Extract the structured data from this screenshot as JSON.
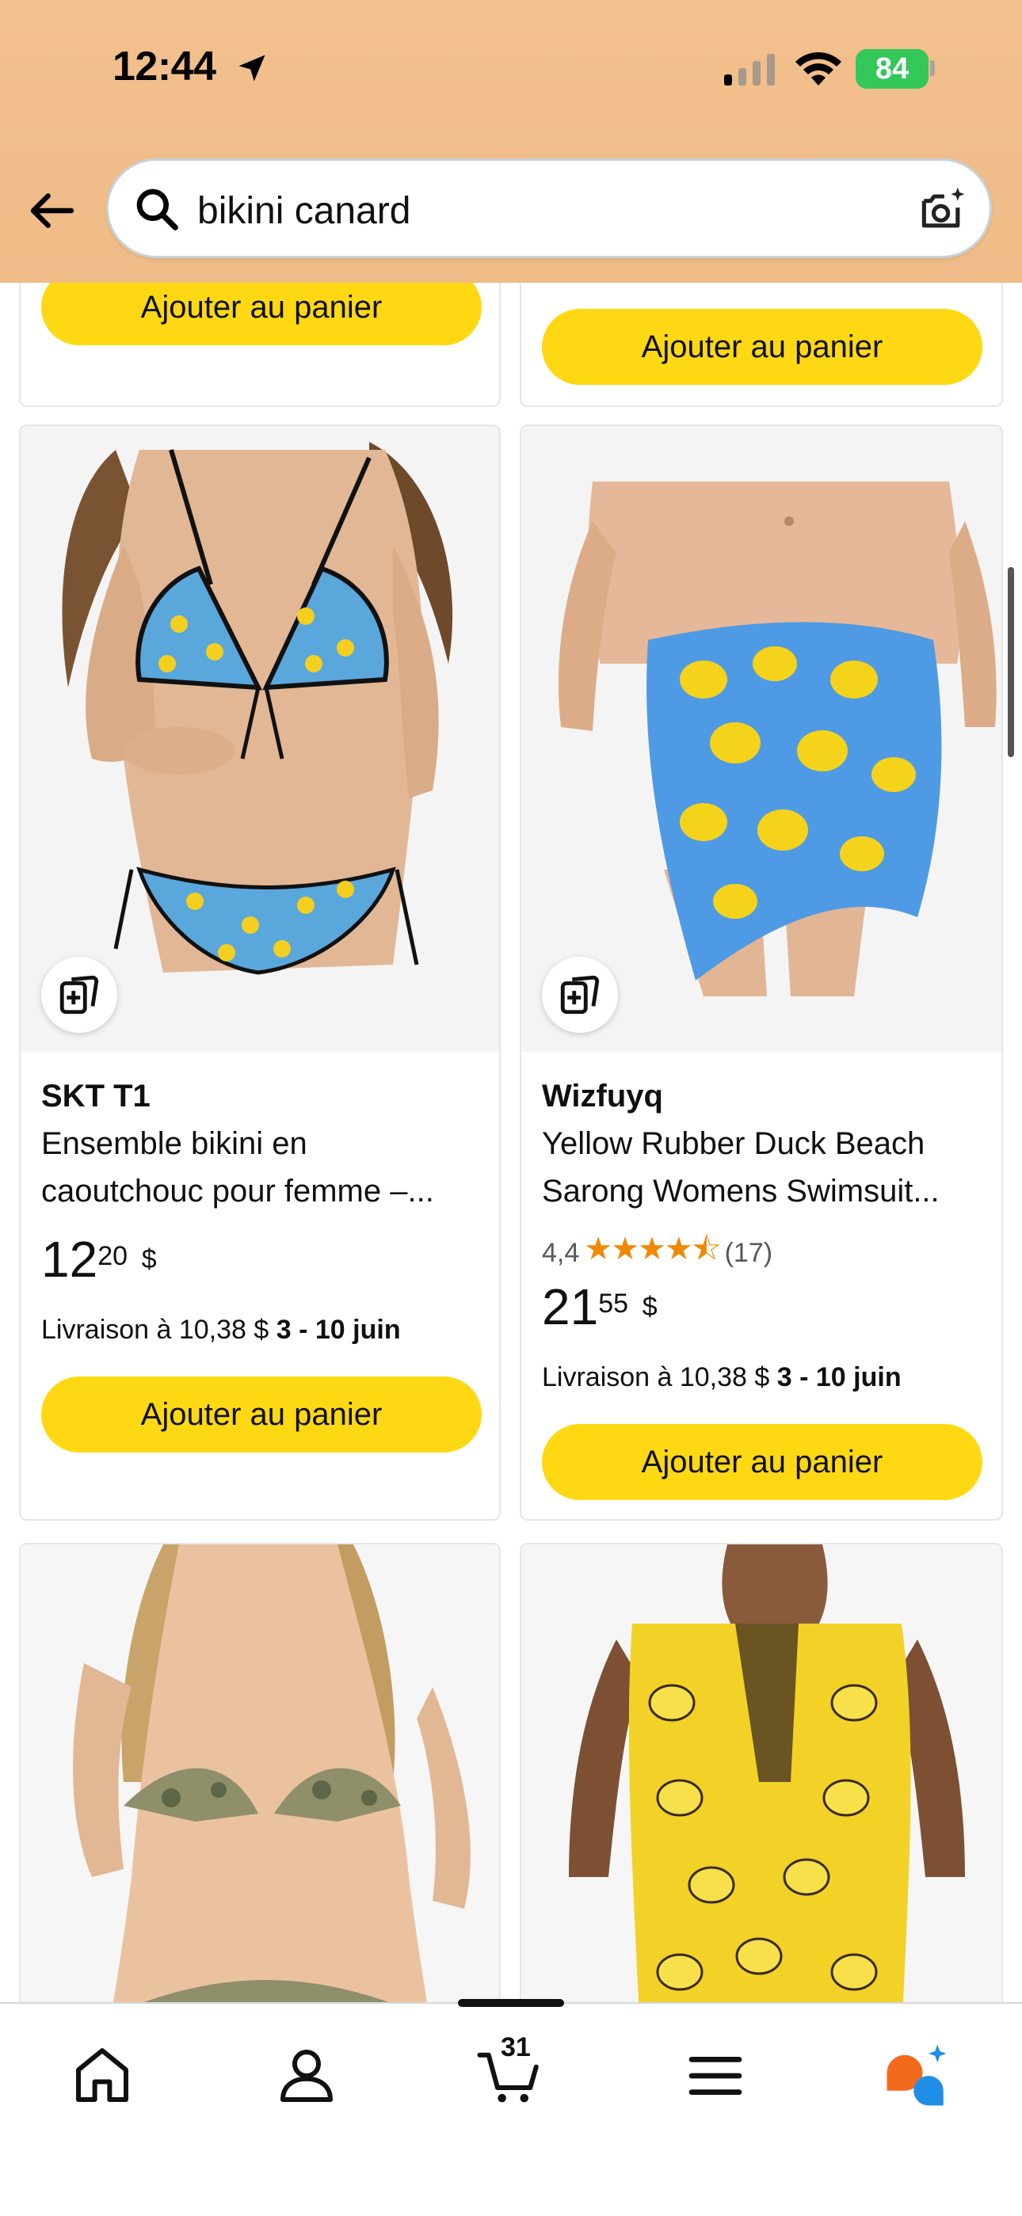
{
  "status_bar": {
    "time": "12:44",
    "battery": "84"
  },
  "search": {
    "query": "bikini canard"
  },
  "top_cards": [
    {
      "button": "Ajouter au panier"
    },
    {
      "button": "Ajouter au panier"
    }
  ],
  "products": [
    {
      "brand": "SKT T1",
      "title_line1": "Ensemble bikini en",
      "title_line2": "caoutchouc pour femme –...",
      "price_whole": "12",
      "price_fraction": "20",
      "currency": "$",
      "delivery_prefix": "Livraison à 10,38 $",
      "delivery_dates": "3 - 10 juin",
      "button": "Ajouter au panier"
    },
    {
      "brand": "Wizfuyq",
      "title_line1": "Yellow Rubber Duck Beach",
      "title_line2": "Sarong Womens Swimsuit...",
      "rating": "4,4",
      "rating_value": 4.4,
      "rating_count": "(17)",
      "stars": "★★★★⯪",
      "price_whole": "21",
      "price_fraction": "55",
      "currency": "$",
      "delivery_prefix": "Livraison à 10,38 $",
      "delivery_dates": "3 - 10 juin",
      "button": "Ajouter au panier"
    }
  ],
  "bottom_nav": {
    "cart_count": "31"
  },
  "colors": {
    "header": "#efbb87",
    "button": "#ffd814",
    "star": "#f08804"
  }
}
